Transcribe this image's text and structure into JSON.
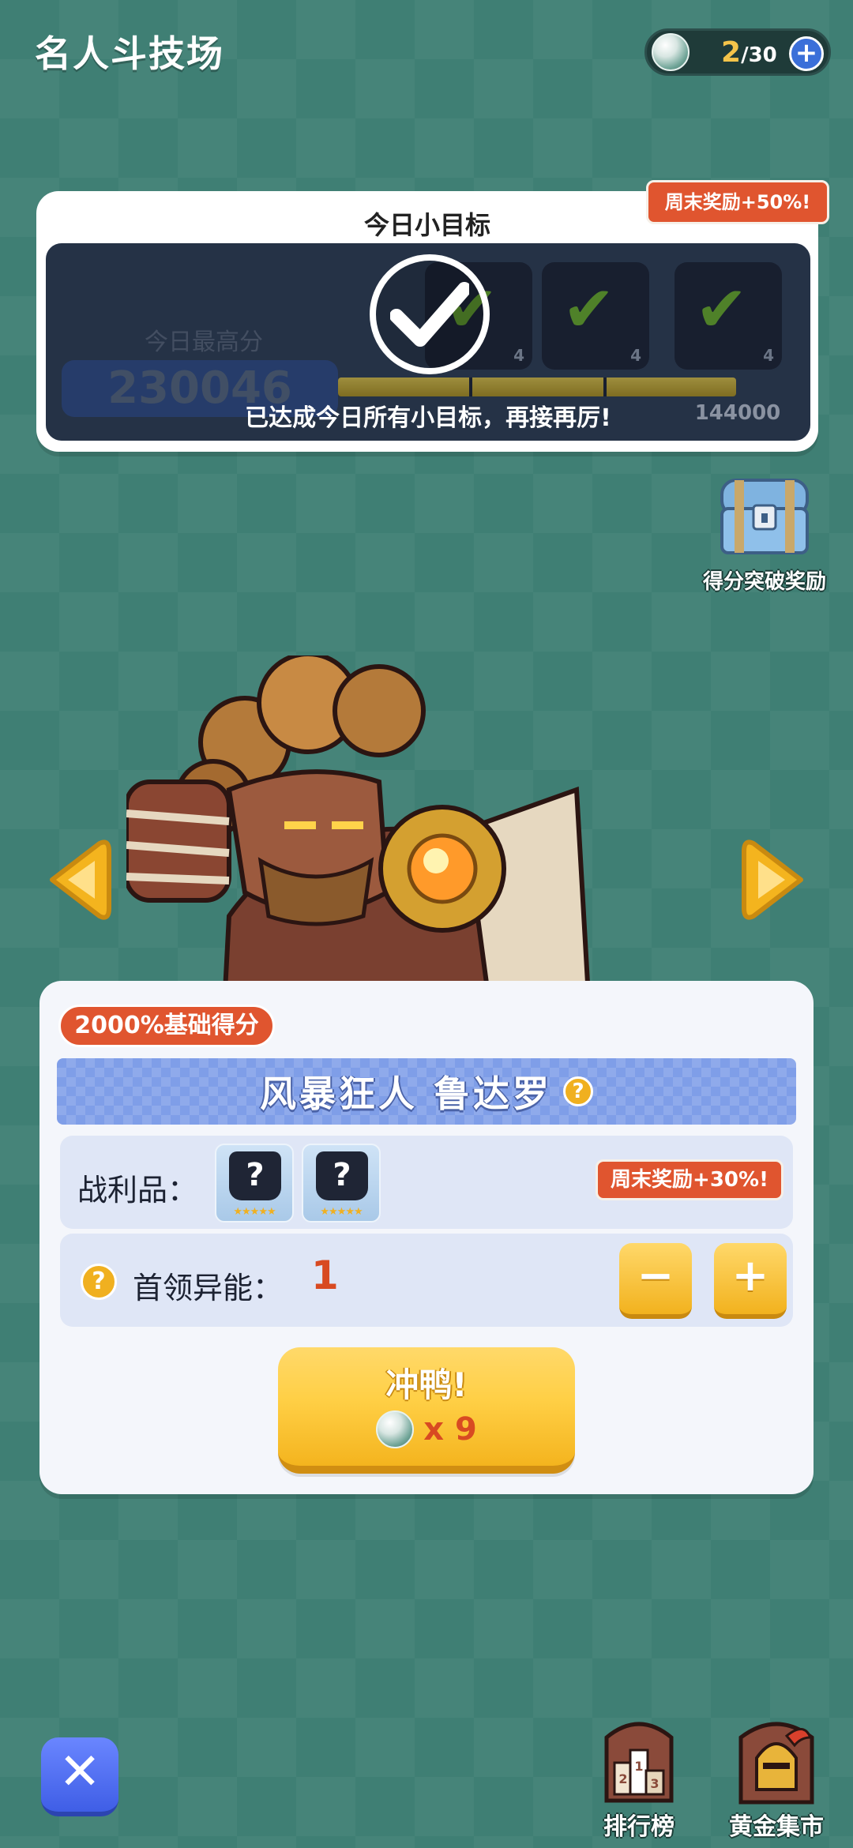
{
  "header": {
    "title": "名人斗技场",
    "currency": {
      "current": "2",
      "separator": "/",
      "max": "30",
      "icon": "gem-icon"
    }
  },
  "daily_goal": {
    "title": "今日小目标",
    "weekend_bonus": "周末奖励+50%!",
    "best_label": "今日最高分",
    "best_value": "230046",
    "reward_count": "4",
    "thresholds": [
      "",
      "",
      "144000"
    ],
    "progress_fraction": 1.0,
    "completed_text": "已达成今日所有小目标，再接再厉!"
  },
  "chest": {
    "label": "得分突破奖励",
    "icon": "chest-icon"
  },
  "boss": {
    "base_score_badge": "2000%基础得分",
    "name": "风暴狂人 鲁达罗",
    "loot_label": "战利品：",
    "loot_items": [
      {
        "placeholder": "?",
        "stars": "★★★★★"
      },
      {
        "placeholder": "?",
        "stars": "★★★★★"
      }
    ],
    "loot_weekend_bonus": "周末奖励+30%!",
    "ability_label": "首领异能：",
    "ability_value": "1",
    "minus_label": "−",
    "plus_label": "+",
    "go_label": "冲鸭!",
    "go_cost": "x 9"
  },
  "bottom": {
    "close_label": "✕",
    "rank_label": "排行榜",
    "market_label": "黄金集市"
  },
  "colors": {
    "background": "#3f7f74",
    "accent_orange": "#e0552f",
    "button_yellow": "#ffcf45",
    "boss_band_blue": "#7f9ee8",
    "close_blue": "#4a68f0"
  }
}
